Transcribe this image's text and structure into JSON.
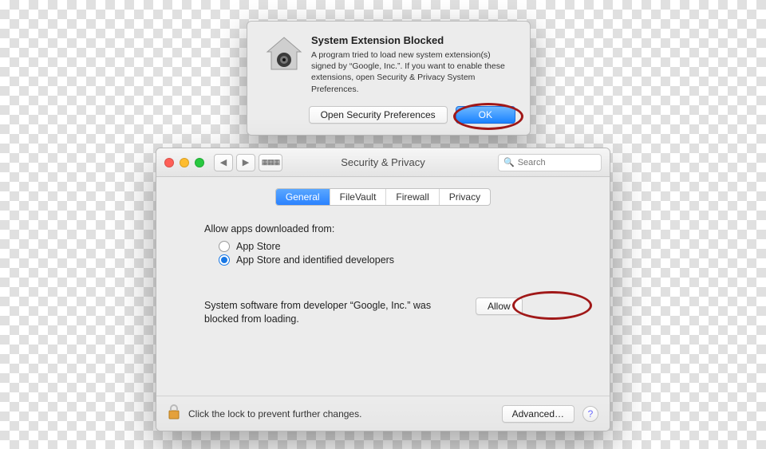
{
  "alert": {
    "title": "System Extension Blocked",
    "message": "A program tried to load new system extension(s) signed by “Google, Inc.”.  If you want to enable these extensions, open Security & Privacy System Preferences.",
    "open_prefs_label": "Open Security Preferences",
    "ok_label": "OK"
  },
  "pref": {
    "window_title": "Security & Privacy",
    "search_placeholder": "Search",
    "tabs": {
      "general": "General",
      "filevault": "FileVault",
      "firewall": "Firewall",
      "privacy": "Privacy"
    },
    "allow_from_label": "Allow apps downloaded from:",
    "radio_app_store": "App Store",
    "radio_app_store_identified": "App Store and identified developers",
    "blocked_message": "System software from developer “Google, Inc.” was blocked from loading.",
    "allow_label": "Allow",
    "lock_hint": "Click the lock to prevent further changes.",
    "advanced_label": "Advanced…",
    "help_label": "?"
  }
}
